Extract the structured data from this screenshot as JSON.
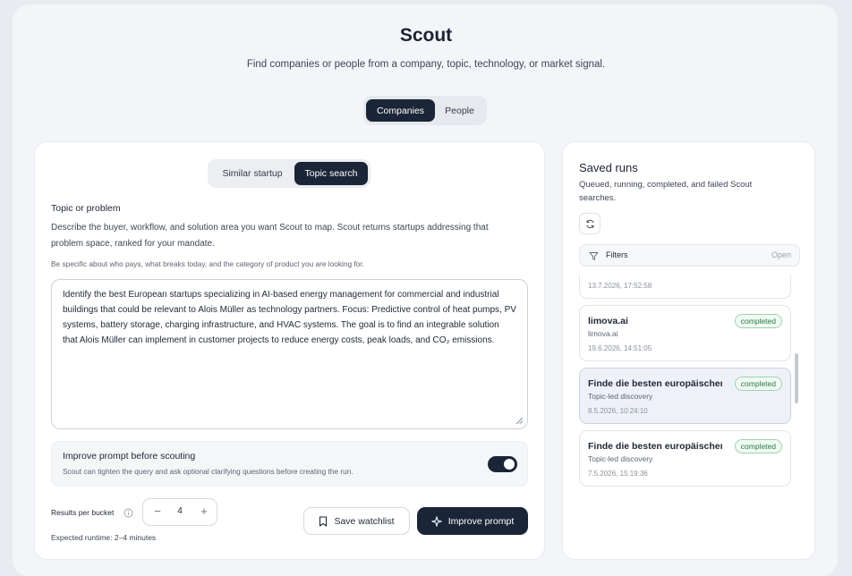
{
  "header": {
    "title": "Scout",
    "subtitle": "Find companies or people from a company, topic, technology, or market signal."
  },
  "mode": {
    "companies": "Companies",
    "people": "People",
    "active": "Companies"
  },
  "search": {
    "tabs": {
      "similar": "Similar startup",
      "topic": "Topic search"
    },
    "active_tab": "Topic search",
    "field_label": "Topic or problem",
    "description": "Describe the buyer, workflow, and solution area you want Scout to map. Scout returns startups addressing that problem space, ranked for your mandate.",
    "hint": "Be specific about who pays, what breaks today, and the category of product you are looking for.",
    "prompt": "Identify the best European startups specializing in AI-based energy management for commercial and industrial buildings that could be relevant to Alois Müller as technology partners. Focus: Predictive control of heat pumps, PV systems, battery storage, charging infrastructure, and HVAC systems. The goal is to find an integrable solution that Alois Müller can implement in customer projects to reduce energy costs, peak loads, and CO₂ emissions.",
    "improve": {
      "title": "Improve prompt before scouting",
      "desc": "Scout can tighten the query and ask optional clarifying questions before creating the run.",
      "enabled": true
    },
    "results_label": "Results per bucket",
    "results_value": "4",
    "runtime": "Expected runtime: 2–4 minutes",
    "save_watchlist": "Save watchlist",
    "improve_prompt": "Improve prompt"
  },
  "runs": {
    "title": "Saved runs",
    "subtitle": "Queued, running, completed, and failed Scout searches.",
    "filters_label": "Filters",
    "filters_action": "Open",
    "partial_date": "13.7.2026, 17:52:58",
    "items": [
      {
        "title": "limova.ai",
        "sub": "limova.ai",
        "date": "19.6.2026, 14:51:05",
        "status": "completed"
      },
      {
        "title": "Finde die besten europäischen ...",
        "sub": "Topic-led discovery",
        "date": "8.5.2026, 10:24:10",
        "status": "completed"
      },
      {
        "title": "Finde die besten europäischen ...",
        "sub": "Topic-led discovery",
        "date": "7.5.2026, 15:19:36",
        "status": "completed"
      }
    ]
  },
  "colors": {
    "accent": "#1b2538",
    "success": "#2b7a47"
  }
}
